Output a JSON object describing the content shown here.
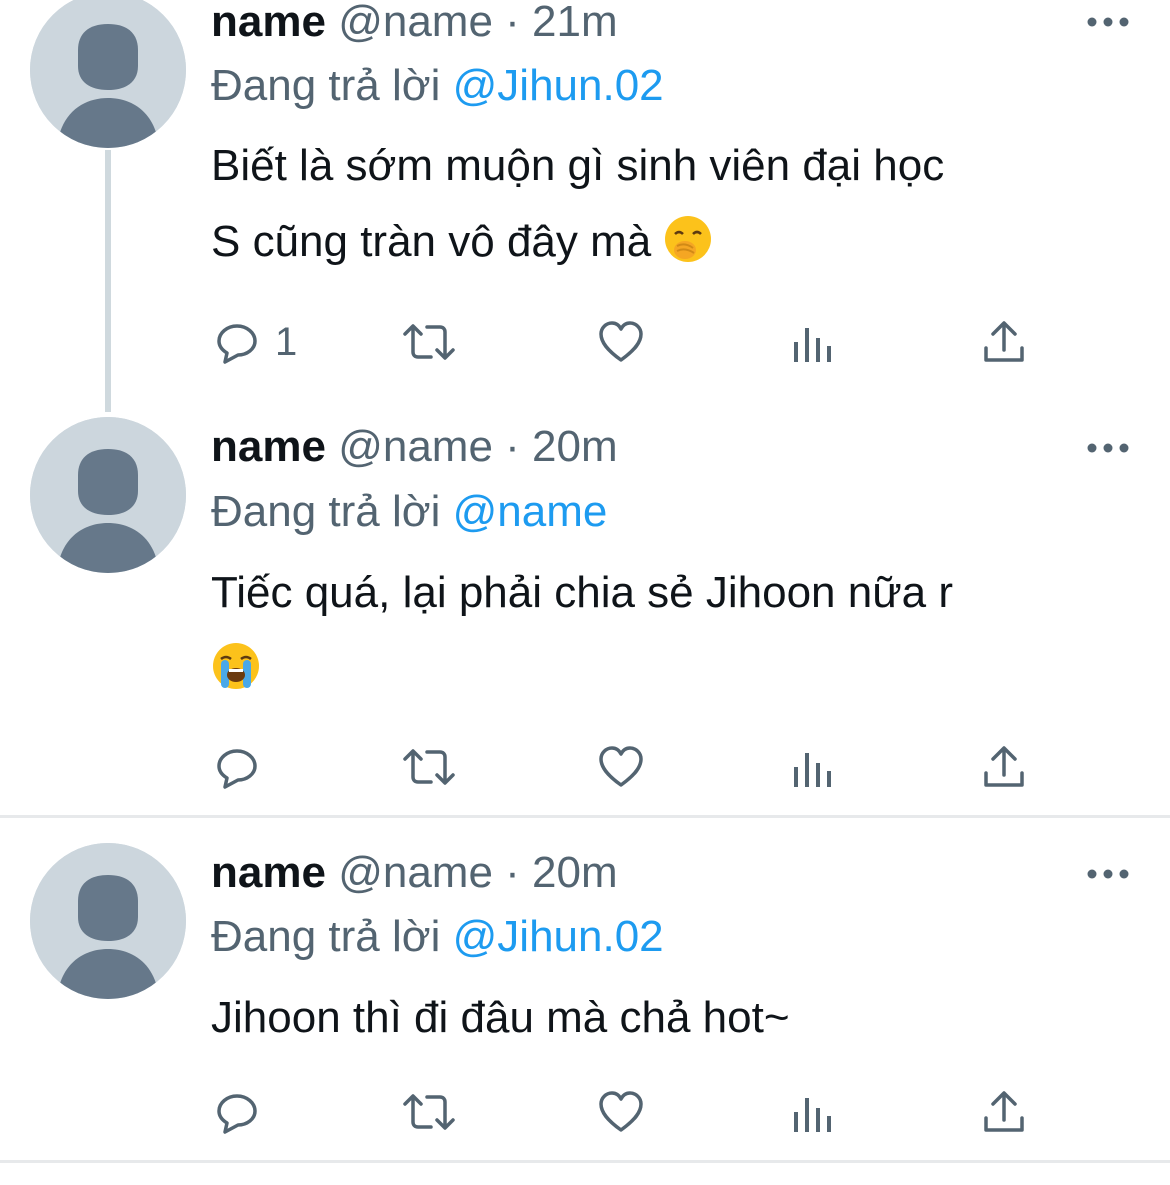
{
  "tweets": [
    {
      "name": "name",
      "handle": "@name",
      "separator": "·",
      "time": "21m",
      "reply_prefix": "Đang trả lời",
      "reply_to": "@Jihun.02",
      "text_lines": [
        "Biết là sớm muộn gì sinh viên đại học",
        "S cũng tràn vô đây mà"
      ],
      "emoji": "face-with-hand-over-mouth",
      "reply_count": "1"
    },
    {
      "name": "name",
      "handle": "@name",
      "separator": "·",
      "time": "20m",
      "reply_prefix": "Đang trả lời",
      "reply_to": "@name",
      "text_lines": [
        "Tiếc quá, lại phải chia sẻ Jihoon nữa r",
        ""
      ],
      "emoji": "loudly-crying-face",
      "reply_count": ""
    },
    {
      "name": "name",
      "handle": "@name",
      "separator": "·",
      "time": "20m",
      "reply_prefix": "Đang trả lời",
      "reply_to": "@Jihun.02",
      "text_lines": [
        "Jihoon thì đi đâu mà chả hot~"
      ],
      "emoji": "",
      "reply_count": ""
    }
  ],
  "icons": [
    "more-icon",
    "reply-icon",
    "retweet-icon",
    "like-icon",
    "analytics-icon",
    "share-icon"
  ],
  "colors": {
    "link": "#1d9bf0",
    "secondary_text": "#536471",
    "avatar_bg": "#ccd6dd",
    "avatar_fg": "#66788a"
  }
}
